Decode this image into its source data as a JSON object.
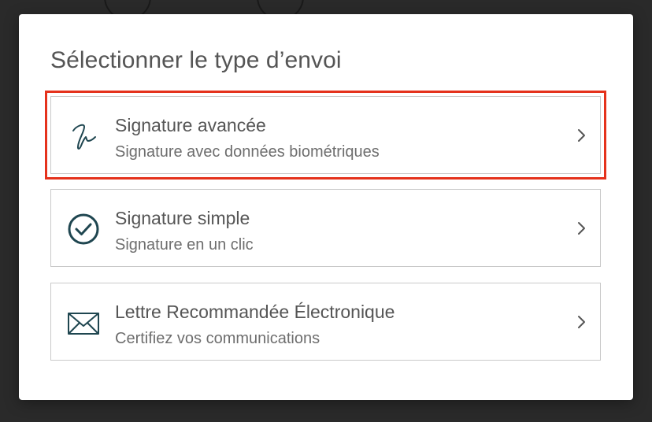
{
  "dialog": {
    "title": "Sélectionner le type d’envoi",
    "options": [
      {
        "title": "Signature avancée",
        "subtitle": "Signature avec données biométriques",
        "icon": "signature-pen-icon",
        "highlighted": true
      },
      {
        "title": "Signature simple",
        "subtitle": "Signature en un clic",
        "icon": "check-circle-icon",
        "highlighted": false
      },
      {
        "title": "Lettre Recommandée Électronique",
        "subtitle": "Certifiez vos communications",
        "icon": "envelope-icon",
        "highlighted": false
      }
    ]
  },
  "colors": {
    "icon": "#1f4650",
    "highlight_border": "#e5321c",
    "option_border": "#c9c9c9",
    "text": "#555555"
  }
}
